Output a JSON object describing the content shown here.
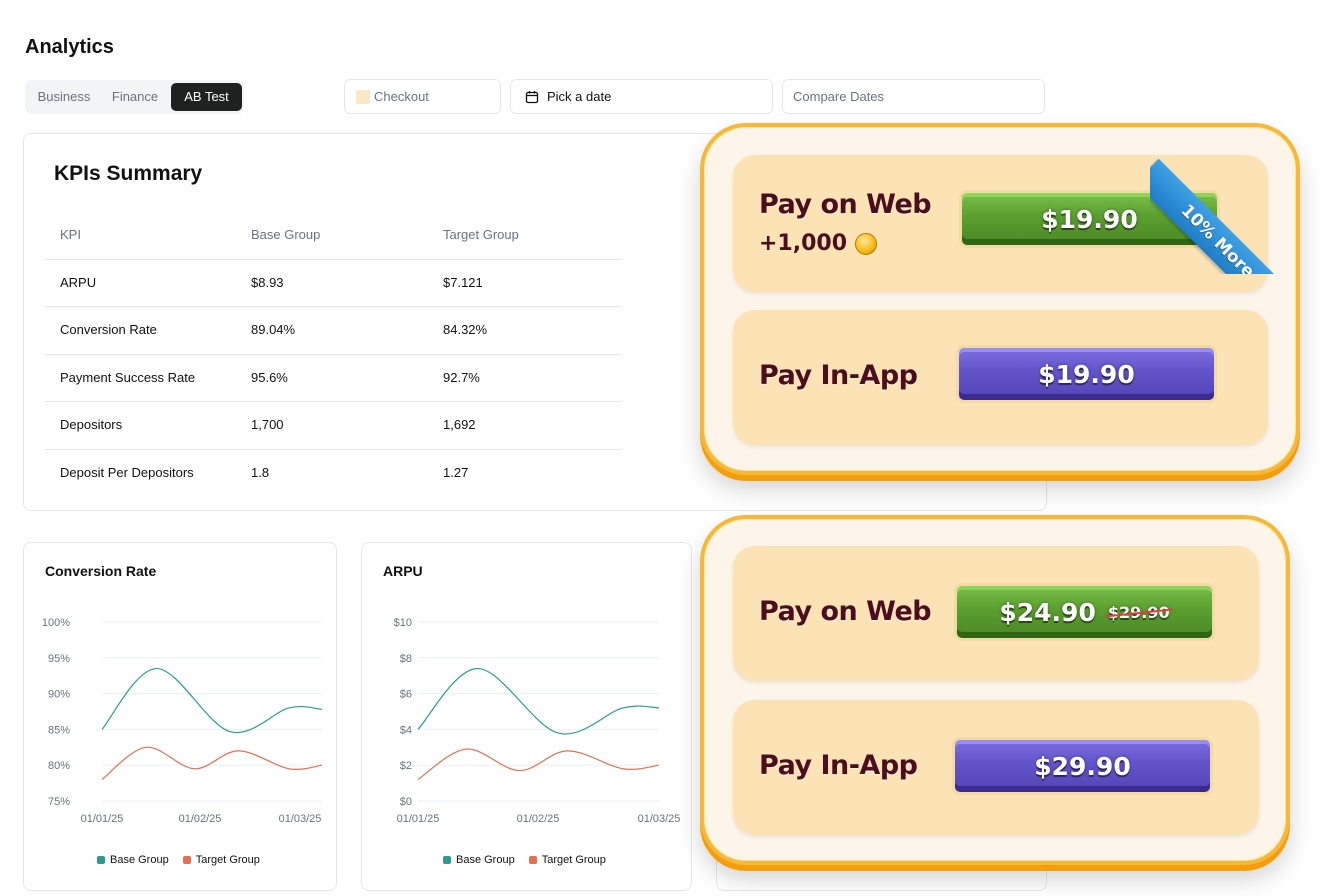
{
  "page": {
    "title": "Analytics"
  },
  "tabs": [
    {
      "label": "Business",
      "active": false
    },
    {
      "label": "Finance",
      "active": false
    },
    {
      "label": "AB Test",
      "active": true
    }
  ],
  "filters": {
    "checkout_placeholder": "Checkout",
    "date_label": "Pick a date",
    "compare_placeholder": "Compare Dates"
  },
  "kpi": {
    "title": "KPIs Summary",
    "headers": [
      "KPI",
      "Base Group",
      "Target Group"
    ],
    "rows": [
      [
        "ARPU",
        "$8.93",
        "$7.121"
      ],
      [
        "Conversion Rate",
        "89.04%",
        "84.32%"
      ],
      [
        "Payment Success Rate",
        "95.6%",
        "92.7%"
      ],
      [
        "Depositors",
        "1,700",
        "1,692"
      ],
      [
        "Deposit Per Depositors",
        "1.8",
        "1.27"
      ]
    ]
  },
  "colors": {
    "base": "#2a9d8f",
    "target": "#e76f51",
    "grid": "#eceff3"
  },
  "legend": {
    "base": "Base Group",
    "target": "Target Group"
  },
  "chart_data": [
    {
      "type": "line",
      "title": "Conversion Rate",
      "y_ticks": [
        "100%",
        "95%",
        "90%",
        "85%",
        "80%",
        "75%"
      ],
      "ylim": [
        75,
        100
      ],
      "x_ticks": [
        "01/01/25",
        "01/02/25",
        "01/03/25"
      ],
      "series": [
        {
          "name": "Base Group",
          "x": [
            0,
            0.25,
            0.58,
            0.85,
            1
          ],
          "values": [
            85,
            93.5,
            84.7,
            88.0,
            87.8
          ]
        },
        {
          "name": "Target Group",
          "x": [
            0,
            0.2,
            0.42,
            0.62,
            0.85,
            1
          ],
          "values": [
            78,
            82.5,
            79.5,
            82.0,
            79.5,
            80.0
          ]
        }
      ]
    },
    {
      "type": "line",
      "title": "ARPU",
      "y_ticks": [
        "$10",
        "$8",
        "$6",
        "$4",
        "$2",
        "$0"
      ],
      "ylim": [
        0,
        10
      ],
      "x_ticks": [
        "01/01/25",
        "01/02/25",
        "01/03/25"
      ],
      "series": [
        {
          "name": "Base Group",
          "x": [
            0,
            0.25,
            0.58,
            0.85,
            1
          ],
          "values": [
            4,
            7.4,
            3.8,
            5.2,
            5.2
          ]
        },
        {
          "name": "Target Group",
          "x": [
            0,
            0.2,
            0.42,
            0.62,
            0.85,
            1
          ],
          "values": [
            1.2,
            2.9,
            1.7,
            2.8,
            1.8,
            2.0
          ]
        }
      ]
    }
  ],
  "pay_offers": {
    "first": {
      "web_label": "Pay on Web",
      "web_bonus": "+1,000",
      "web_price": "$19.90",
      "ribbon": "10% More",
      "app_label": "Pay In-App",
      "app_price": "$19.90"
    },
    "second": {
      "web_label": "Pay on Web",
      "web_price": "$24.90",
      "web_old_price": "$29.90",
      "app_label": "Pay In-App",
      "app_price": "$29.90"
    }
  }
}
